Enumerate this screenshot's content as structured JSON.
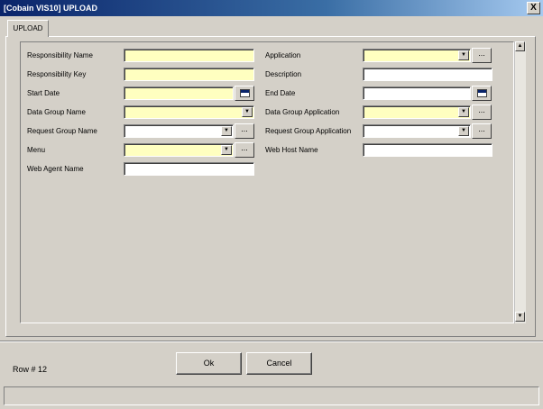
{
  "window": {
    "title": "[Cobain VIS10] UPLOAD",
    "close_label": "X"
  },
  "tab": {
    "label": "UPLOAD"
  },
  "left_fields": [
    {
      "label": "Responsibility Name"
    },
    {
      "label": "Responsibility Key"
    },
    {
      "label": "Start Date"
    },
    {
      "label": "Data Group Name"
    },
    {
      "label": "Request Group Name"
    },
    {
      "label": "Menu"
    },
    {
      "label": "Web Agent Name"
    }
  ],
  "right_fields": [
    {
      "label": "Application"
    },
    {
      "label": "Description"
    },
    {
      "label": "End Date"
    },
    {
      "label": "Data Group Application"
    },
    {
      "label": "Request Group Application"
    },
    {
      "label": "Web Host Name"
    }
  ],
  "buttons": {
    "ok": "Ok",
    "cancel": "Cancel",
    "ellipsis": "..."
  },
  "status": {
    "row": "Row # 12"
  },
  "colors": {
    "required": "#ffffc0",
    "titlebar_start": "#0a246a",
    "titlebar_end": "#a6caf0"
  }
}
